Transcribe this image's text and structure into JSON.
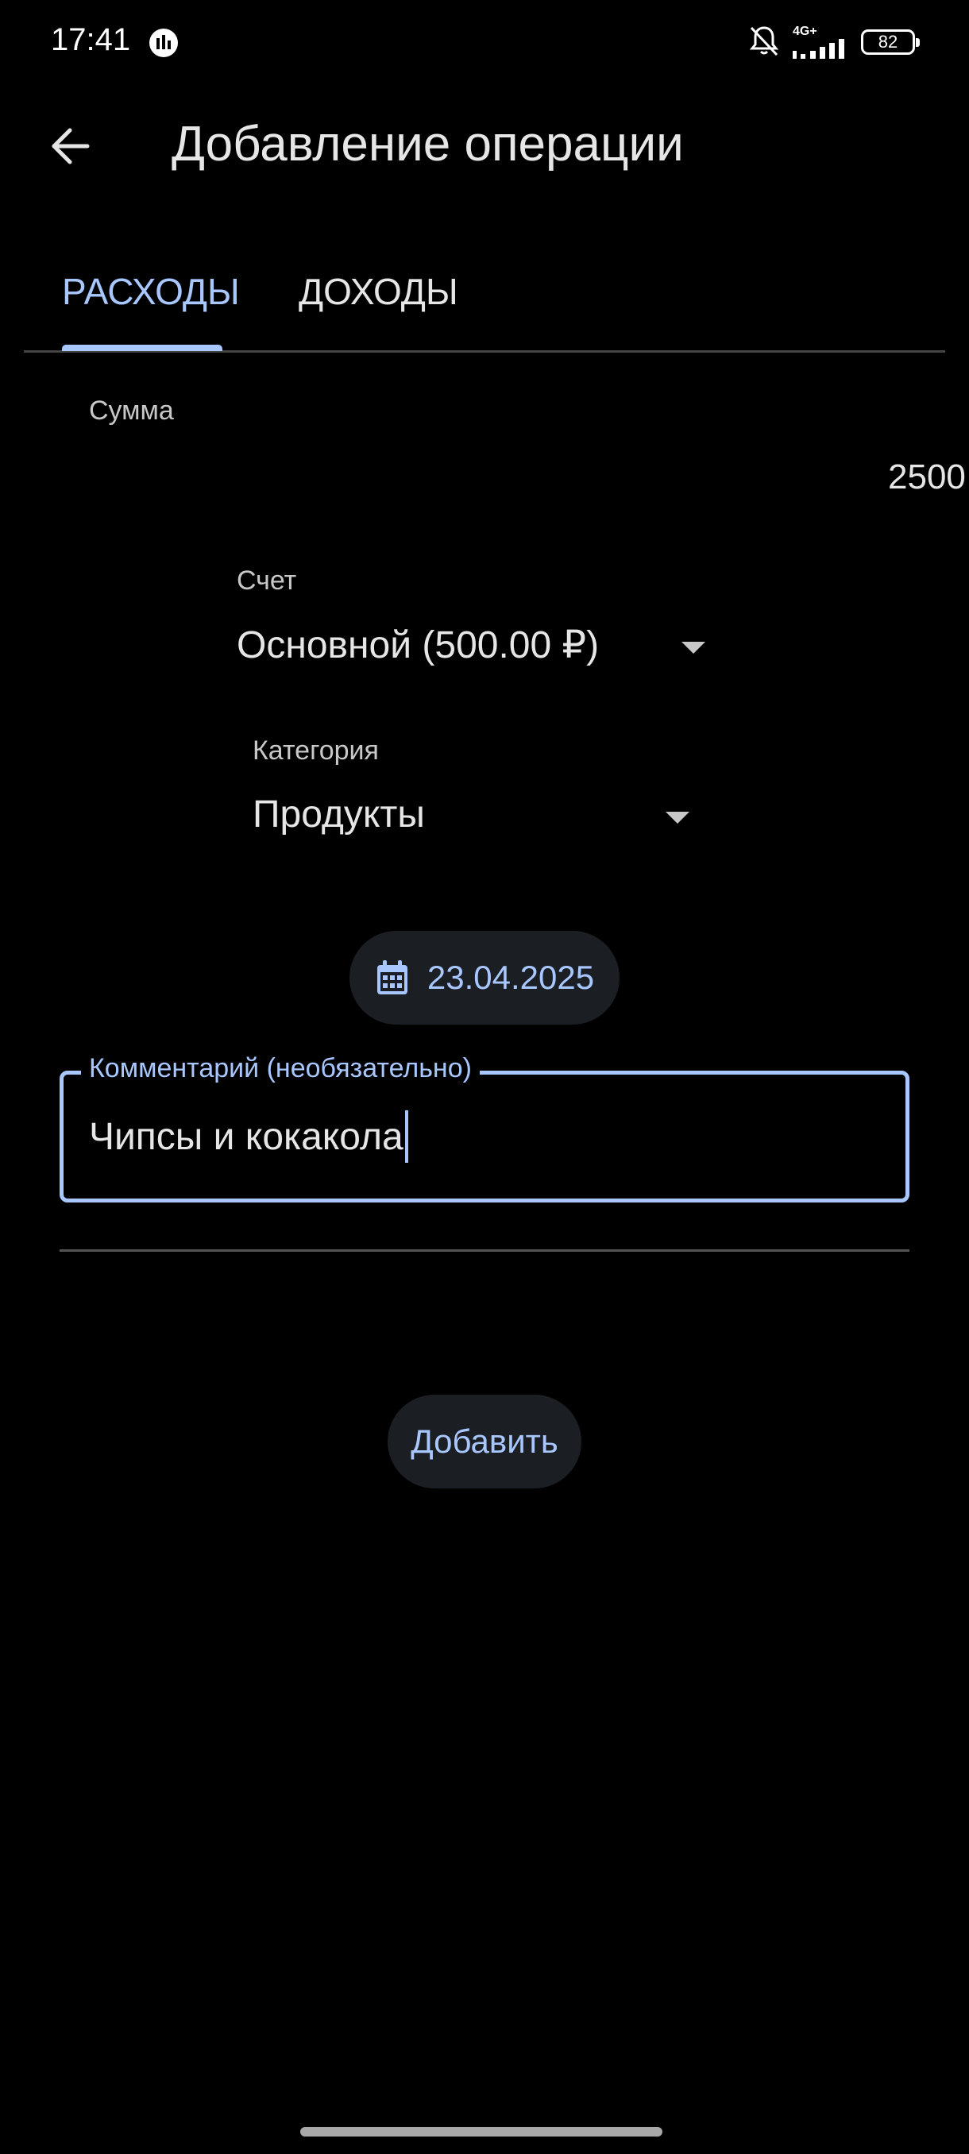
{
  "status_bar": {
    "time": "17:41",
    "network_label": "4G+",
    "battery_level": "82",
    "icons": [
      "activity-icon",
      "bell-off-icon",
      "signal-icon",
      "battery-icon"
    ]
  },
  "header": {
    "title": "Добавление операции",
    "back_icon": "arrow-left-icon"
  },
  "tabs": [
    {
      "label": "РАСХОДЫ",
      "selected": true
    },
    {
      "label": "ДОХОДЫ",
      "selected": false
    }
  ],
  "form": {
    "amount": {
      "label": "Сумма",
      "value": "2500"
    },
    "account": {
      "label": "Счет",
      "value": "Основной (500.00 ₽)"
    },
    "category": {
      "label": "Категория",
      "value": "Продукты"
    },
    "date": {
      "value": "23.04.2025",
      "icon": "calendar-icon"
    },
    "comment": {
      "label": "Комментарий (необязательно)",
      "value": "Чипсы и кокакола"
    }
  },
  "actions": {
    "add_label": "Добавить"
  },
  "colors": {
    "accent": "#a9c7ff",
    "background": "#000000",
    "chip_background": "#1b1f24",
    "text": "#e6e6e6"
  }
}
